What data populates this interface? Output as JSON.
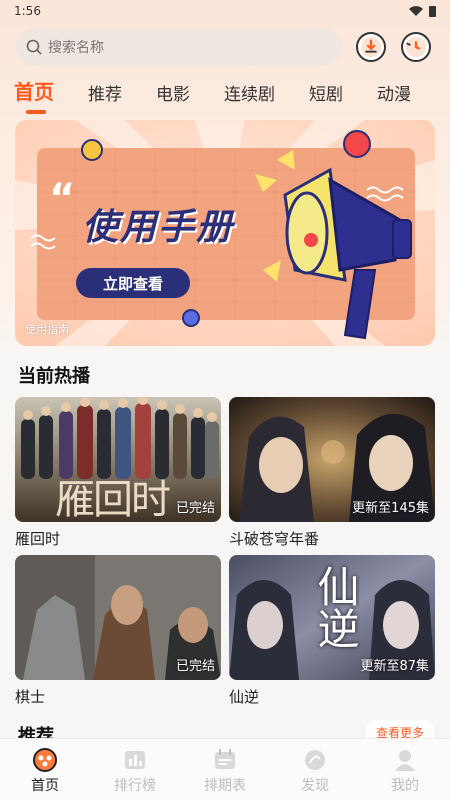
{
  "status_bar": {
    "time": "1:56"
  },
  "search": {
    "placeholder": "搜索名称"
  },
  "tabs": [
    {
      "label": "首页",
      "active": true
    },
    {
      "label": "推荐"
    },
    {
      "label": "电影"
    },
    {
      "label": "连续剧"
    },
    {
      "label": "短剧"
    },
    {
      "label": "动漫"
    }
  ],
  "banner": {
    "headline": "使用手册",
    "button_label": "立即查看",
    "caption": "使用指南"
  },
  "hot": {
    "title": "当前热播",
    "items": [
      {
        "title": "雁回时",
        "badge": "已完结",
        "poster_text": "雁回时"
      },
      {
        "title": "斗破苍穹年番",
        "badge": "更新至145集"
      },
      {
        "title": "棋士",
        "badge": "已完结"
      },
      {
        "title": "仙逆",
        "badge": "更新至87集",
        "poster_text": "仙逆"
      }
    ]
  },
  "recommend": {
    "title": "推荐",
    "more_label": "查看更多"
  },
  "bottom_nav": [
    {
      "label": "首页",
      "icon": "home-icon",
      "active": true
    },
    {
      "label": "排行榜",
      "icon": "chart-icon"
    },
    {
      "label": "排期表",
      "icon": "calendar-icon"
    },
    {
      "label": "发现",
      "icon": "discover-icon"
    },
    {
      "label": "我的",
      "icon": "user-icon"
    }
  ],
  "colors": {
    "accent": "#ff5a1f",
    "banner_bg": "#f2a37f",
    "banner_button": "#2b2f7a"
  }
}
